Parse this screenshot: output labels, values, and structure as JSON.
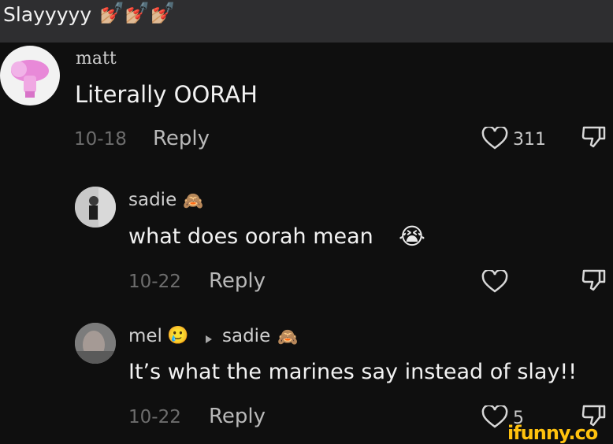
{
  "header": {
    "text": "Slayyyyy",
    "emoji": "💅🏼💅🏼💅🏼"
  },
  "comments": [
    {
      "username": "matt",
      "text": "Literally OORAH",
      "date": "10-18",
      "reply_label": "Reply",
      "likes": "311"
    },
    {
      "username": "sadie",
      "username_emoji": "🙈",
      "text": "what does oorah mean",
      "text_emoji": "😭",
      "date": "10-22",
      "reply_label": "Reply",
      "likes": ""
    },
    {
      "username": "mel",
      "username_emoji": "🥲",
      "reply_to": "sadie",
      "reply_to_emoji": "🙈",
      "text": "It’s what the marines say instead of slay!!",
      "date": "10-22",
      "reply_label": "Reply",
      "likes": "5"
    }
  ],
  "watermark": "ifunny.co",
  "icons": {
    "like": "heart-outline-icon",
    "dislike": "thumbs-down-icon",
    "reply_arrow": "play-triangle-icon"
  },
  "colors": {
    "background": "#0f0f0f",
    "header_bar": "#2e2e30",
    "date": "#6d6d6d",
    "watermark": "#ffc20e"
  }
}
